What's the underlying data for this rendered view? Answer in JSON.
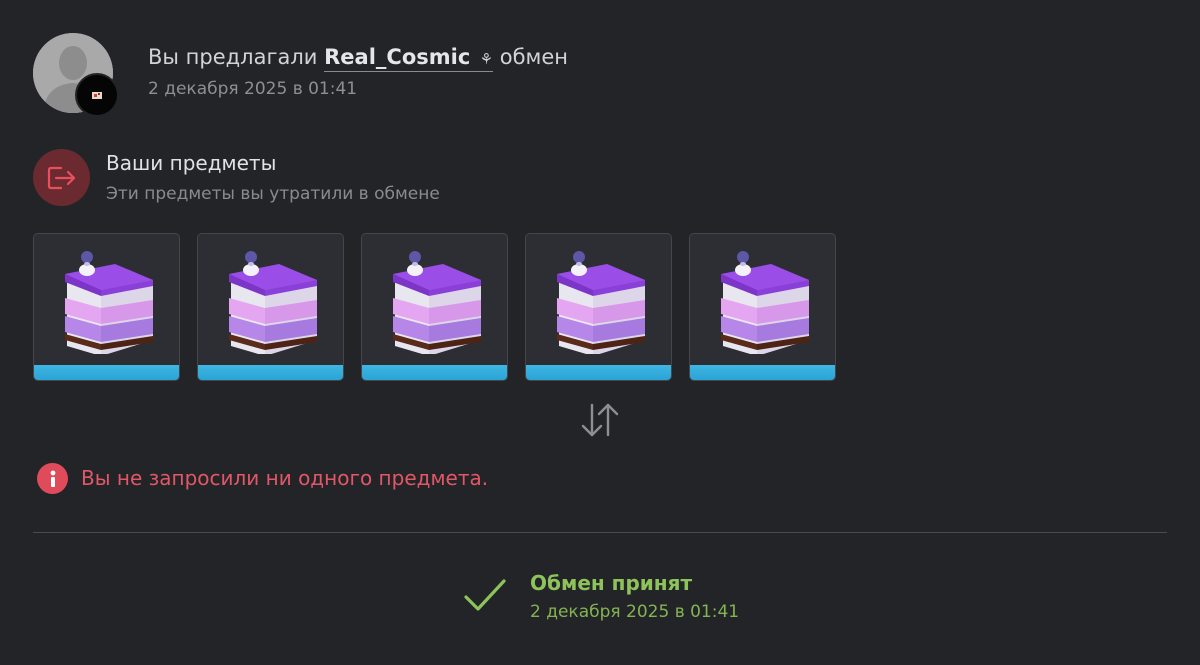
{
  "header": {
    "prefix": "Вы предлагали",
    "username": "Real_Cosmic",
    "username_badge": "⚘",
    "suffix": "обмен",
    "date": "2 декабря 2025 в 01:41"
  },
  "section": {
    "title": "Ваши предметы",
    "subtitle": "Эти предметы вы утратили в обмене",
    "icon": "exit-icon"
  },
  "items": [
    {
      "icon": "cake-slice-icon",
      "rarity_color": "#2fa8da"
    },
    {
      "icon": "cake-slice-icon",
      "rarity_color": "#2fa8da"
    },
    {
      "icon": "cake-slice-icon",
      "rarity_color": "#2fa8da"
    },
    {
      "icon": "cake-slice-icon",
      "rarity_color": "#2fa8da"
    },
    {
      "icon": "cake-slice-icon",
      "rarity_color": "#2fa8da"
    }
  ],
  "warning": {
    "text": "Вы не запросили ни одного предмета.",
    "color": "#e25767"
  },
  "status": {
    "title": "Обмен принят",
    "date": "2 декабря 2025 в 01:41",
    "color": "#8ec35b"
  }
}
